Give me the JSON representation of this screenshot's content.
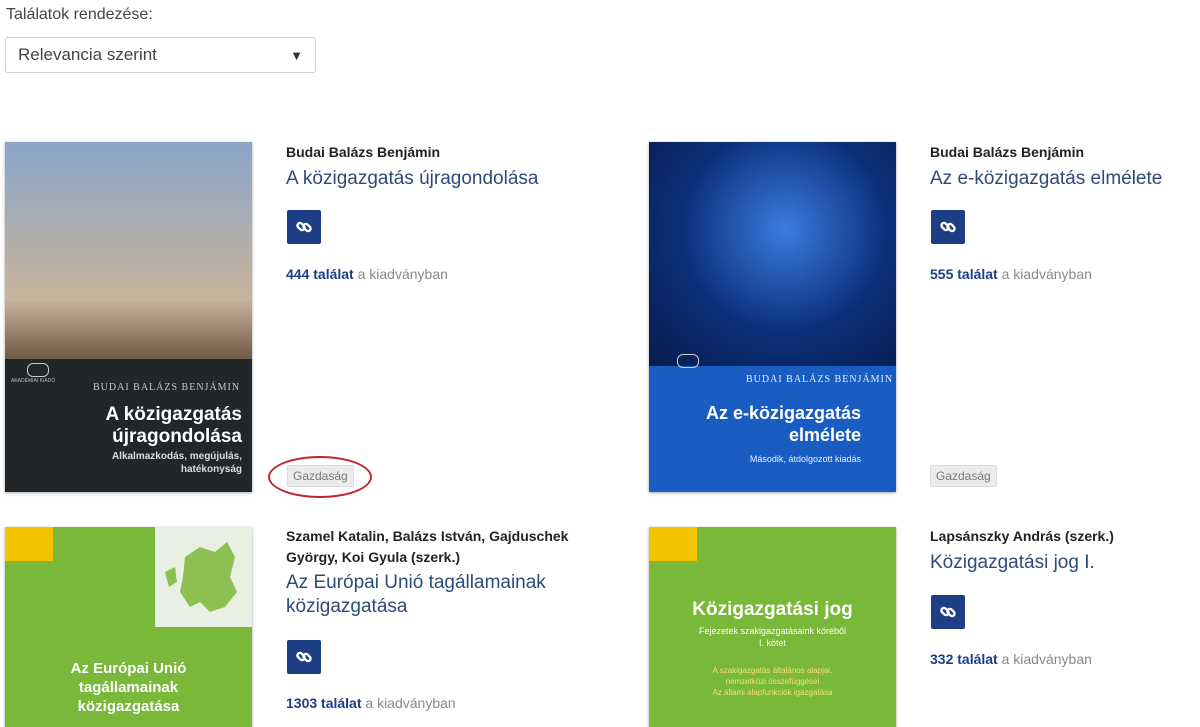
{
  "sort": {
    "label": "Találatok rendezése:",
    "selected": "Relevancia szerint",
    "arrow": "▼"
  },
  "hits_suffix": "a kiadványban",
  "results": [
    {
      "author": "Budai Balázs Benjámin",
      "title": "A közigazgatás újragondolása",
      "hits": "444 találat",
      "tag": "Gazdaság",
      "cover": {
        "author": "BUDAI BALÁZS BENJÁMIN",
        "title_line1": "A közigazgatás",
        "title_line2": "újragondolása",
        "sub_line1": "Alkalmazkodás, megújulás,",
        "sub_line2": "hatékonyság",
        "publisher": "AKADÉMIAI KIADÓ"
      }
    },
    {
      "author": "Budai Balázs Benjámin",
      "title": "Az e-közigazgatás elmélete",
      "hits": "555 találat",
      "tag": "Gazdaság",
      "cover": {
        "author": "BUDAI BALÁZS BENJÁMIN",
        "title_line1": "Az e-közigazgatás",
        "title_line2": "elmélete",
        "sub": "Második, átdolgozott kiadás"
      }
    },
    {
      "author_line1": "Szamel Katalin, Balázs István, Gajduschek",
      "author_line2": "György, Koi Gyula (szerk.)",
      "title_line1": "Az Európai Unió tagállamainak",
      "title_line2": "közigazgatása",
      "hits": "1303 találat",
      "cover": {
        "title_line1": "Az Európai Unió",
        "title_line2": "tagállamainak",
        "title_line3": "közigazgatása"
      }
    },
    {
      "author": "Lapsánszky András (szerk.)",
      "title": "Közigazgatási jog I.",
      "hits": "332 találat",
      "cover": {
        "title": "Közigazgatási jog",
        "sub_line1": "Fejezetek szakigazgatásaink köréből",
        "sub_line2": "I. kötet",
        "sub2_line1": "A szakigazgatás általános alapjai,",
        "sub2_line2": "nemzetközi összefüggései",
        "sub2_line3": "Az állami alapfunkciók igazgatása"
      }
    }
  ],
  "colors": {
    "accent": "#1d3e85",
    "title_link": "#2c4b7a",
    "highlight": "#c0262d"
  },
  "icons": {
    "link": "link-icon"
  }
}
